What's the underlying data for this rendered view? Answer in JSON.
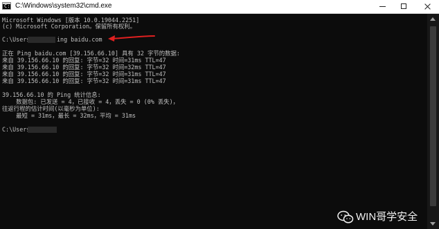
{
  "window": {
    "title": "C:\\Windows\\system32\\cmd.exe"
  },
  "console": {
    "lines": [
      "Microsoft Windows [版本 10.0.19044.2251]",
      "(c) Microsoft Corporation。保留所有权利。",
      "",
      "C:\\Users",
      "ing baidu.com",
      "",
      "正在 Ping baidu.com [39.156.66.10] 具有 32 字节的数据:",
      "来自 39.156.66.10 的回复: 字节=32 时间=31ms TTL=47",
      "来自 39.156.66.10 的回复: 字节=32 时间=32ms TTL=47",
      "来自 39.156.66.10 的回复: 字节=32 时间=31ms TTL=47",
      "来自 39.156.66.10 的回复: 字节=32 时间=31ms TTL=47",
      "",
      "39.156.66.10 的 Ping 统计信息:",
      "    数据包: 已发送 = 4，已接收 = 4，丢失 = 0 (0% 丢失)，",
      "往返行程的估计时间(以毫秒为单位):",
      "    最短 = 31ms，最长 = 32ms，平均 = 31ms",
      "",
      "C:\\Users"
    ]
  },
  "watermark": {
    "text": "WIN哥学安全"
  },
  "colors": {
    "console_bg": "#0c0c0c",
    "console_text": "#c0c0c0",
    "annotation_arrow": "#e02020"
  },
  "icons": {
    "app": "cmd-icon",
    "minimize": "minimize-icon",
    "maximize": "maximize-icon",
    "close": "close-icon",
    "watermark": "wechat-icon"
  }
}
